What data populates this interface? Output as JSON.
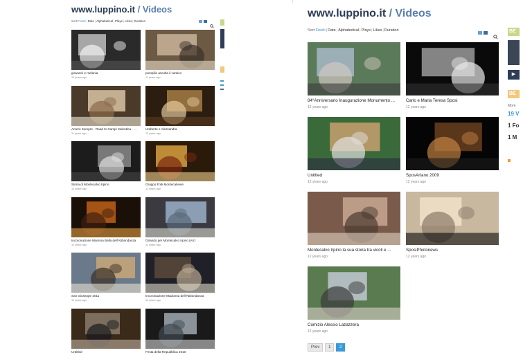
{
  "left": {
    "title": "www.luppino.it",
    "title_sep": "/",
    "title_sub": "Videos",
    "sort": {
      "label": "Sort:",
      "options": [
        "Fresh",
        "Date",
        "Alphabetical",
        "Plays",
        "Likes",
        "Duration"
      ],
      "active": "Fresh"
    },
    "videos": [
      {
        "title": "giovanni e melania",
        "date": "10 years ago"
      },
      {
        "title": "pompilio ascolta il cantico",
        "date": "11 years ago"
      },
      {
        "title": "Amerò Sempre - Road to Campi Salentina - ...",
        "date": "11 years ago"
      },
      {
        "title": "Umberto e Alessandra",
        "date": "12 years ago"
      },
      {
        "title": "Storia di Montecalvo Irpino",
        "date": "12 years ago"
      },
      {
        "title": "Gruppo Folk Montecalvese",
        "date": "12 years ago"
      },
      {
        "title": "Incoronazione Mamma Bella dell'Abbondanza",
        "date": "12 years ago"
      },
      {
        "title": "Girando per Montecalvo Irpino (AV)",
        "date": "12 years ago"
      },
      {
        "title": "San Giuseppe 2011",
        "date": "12 years ago"
      },
      {
        "title": "Incoronazione Madonna dell'Abbondanza",
        "date": "12 years ago"
      },
      {
        "title": "Untitled",
        "date": ""
      },
      {
        "title": "Festa della Repubblica 2010",
        "date": ""
      }
    ]
  },
  "right": {
    "title": "www.luppino.it",
    "title_sep": "/",
    "title_sub": "Videos",
    "sort": {
      "label": "Sort:",
      "options": [
        "Fresh",
        "Date",
        "Alphabetical",
        "Plays",
        "Likes",
        "Duration"
      ],
      "active": "Fresh"
    },
    "videos": [
      {
        "title": "84°Anniversario Inaugurazione Monumento ...",
        "date": "12 years ago"
      },
      {
        "title": "Carlo e Maria Teresa Sposi",
        "date": "12 years ago"
      },
      {
        "title": "Untitled",
        "date": "12 years ago"
      },
      {
        "title": "SposArIano 2009",
        "date": "12 years ago"
      },
      {
        "title": "Montecalvo Irpino la sua storia tra vicoli e ...",
        "date": "12 years ago"
      },
      {
        "title": "SposiPhotonews",
        "date": "12 years ago"
      },
      {
        "title": "Comizio Alessio Lazazzera",
        "date": "12 years ago"
      }
    ],
    "pager": {
      "prev": "Prev",
      "pages": [
        "1",
        "2"
      ],
      "current": "2"
    },
    "sidebar": {
      "badge1": "BE",
      "badge2": "BE",
      "more": "More",
      "n1": "19 V",
      "n2": "1 Fo",
      "n3": "1 M"
    }
  },
  "colors": {
    "title": "#2b3a55",
    "accent": "#3a9ad9",
    "badge": "#c8d88a"
  }
}
